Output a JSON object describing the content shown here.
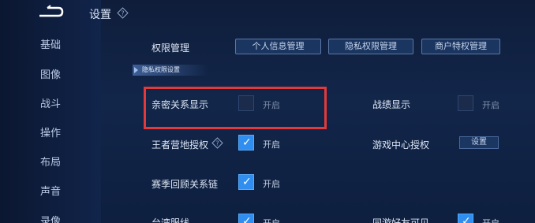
{
  "header": {
    "title": "设置"
  },
  "sidebar": {
    "items": [
      {
        "label": "基础"
      },
      {
        "label": "图像"
      },
      {
        "label": "战斗"
      },
      {
        "label": "操作"
      },
      {
        "label": "布局"
      },
      {
        "label": "声音"
      },
      {
        "label": "录像"
      }
    ]
  },
  "permissions": {
    "label": "权限管理",
    "buttons": [
      {
        "label": "个人信息管理"
      },
      {
        "label": "隐私权限管理"
      },
      {
        "label": "商户特权管理"
      }
    ]
  },
  "section": {
    "label": "隐私权限设置"
  },
  "settings": [
    {
      "label": "亲密关系显示",
      "state": "开启",
      "checked": false
    },
    {
      "label": "战绩显示",
      "state": "开启",
      "checked": false
    },
    {
      "label": "王者营地授权",
      "state": "开启",
      "checked": true
    },
    {
      "label": "游戏中心授权",
      "button": "设置"
    },
    {
      "label": "赛季回顾关系链",
      "state": "开启",
      "checked": true
    },
    {
      "label": "台湾服线",
      "state": "开启",
      "checked": true
    },
    {
      "label": "同游好友可见",
      "state": "开启",
      "checked": true
    }
  ],
  "colors": {
    "highlight": "#e23a3a",
    "checked": "#2f8ef0",
    "background": "#12264a"
  }
}
